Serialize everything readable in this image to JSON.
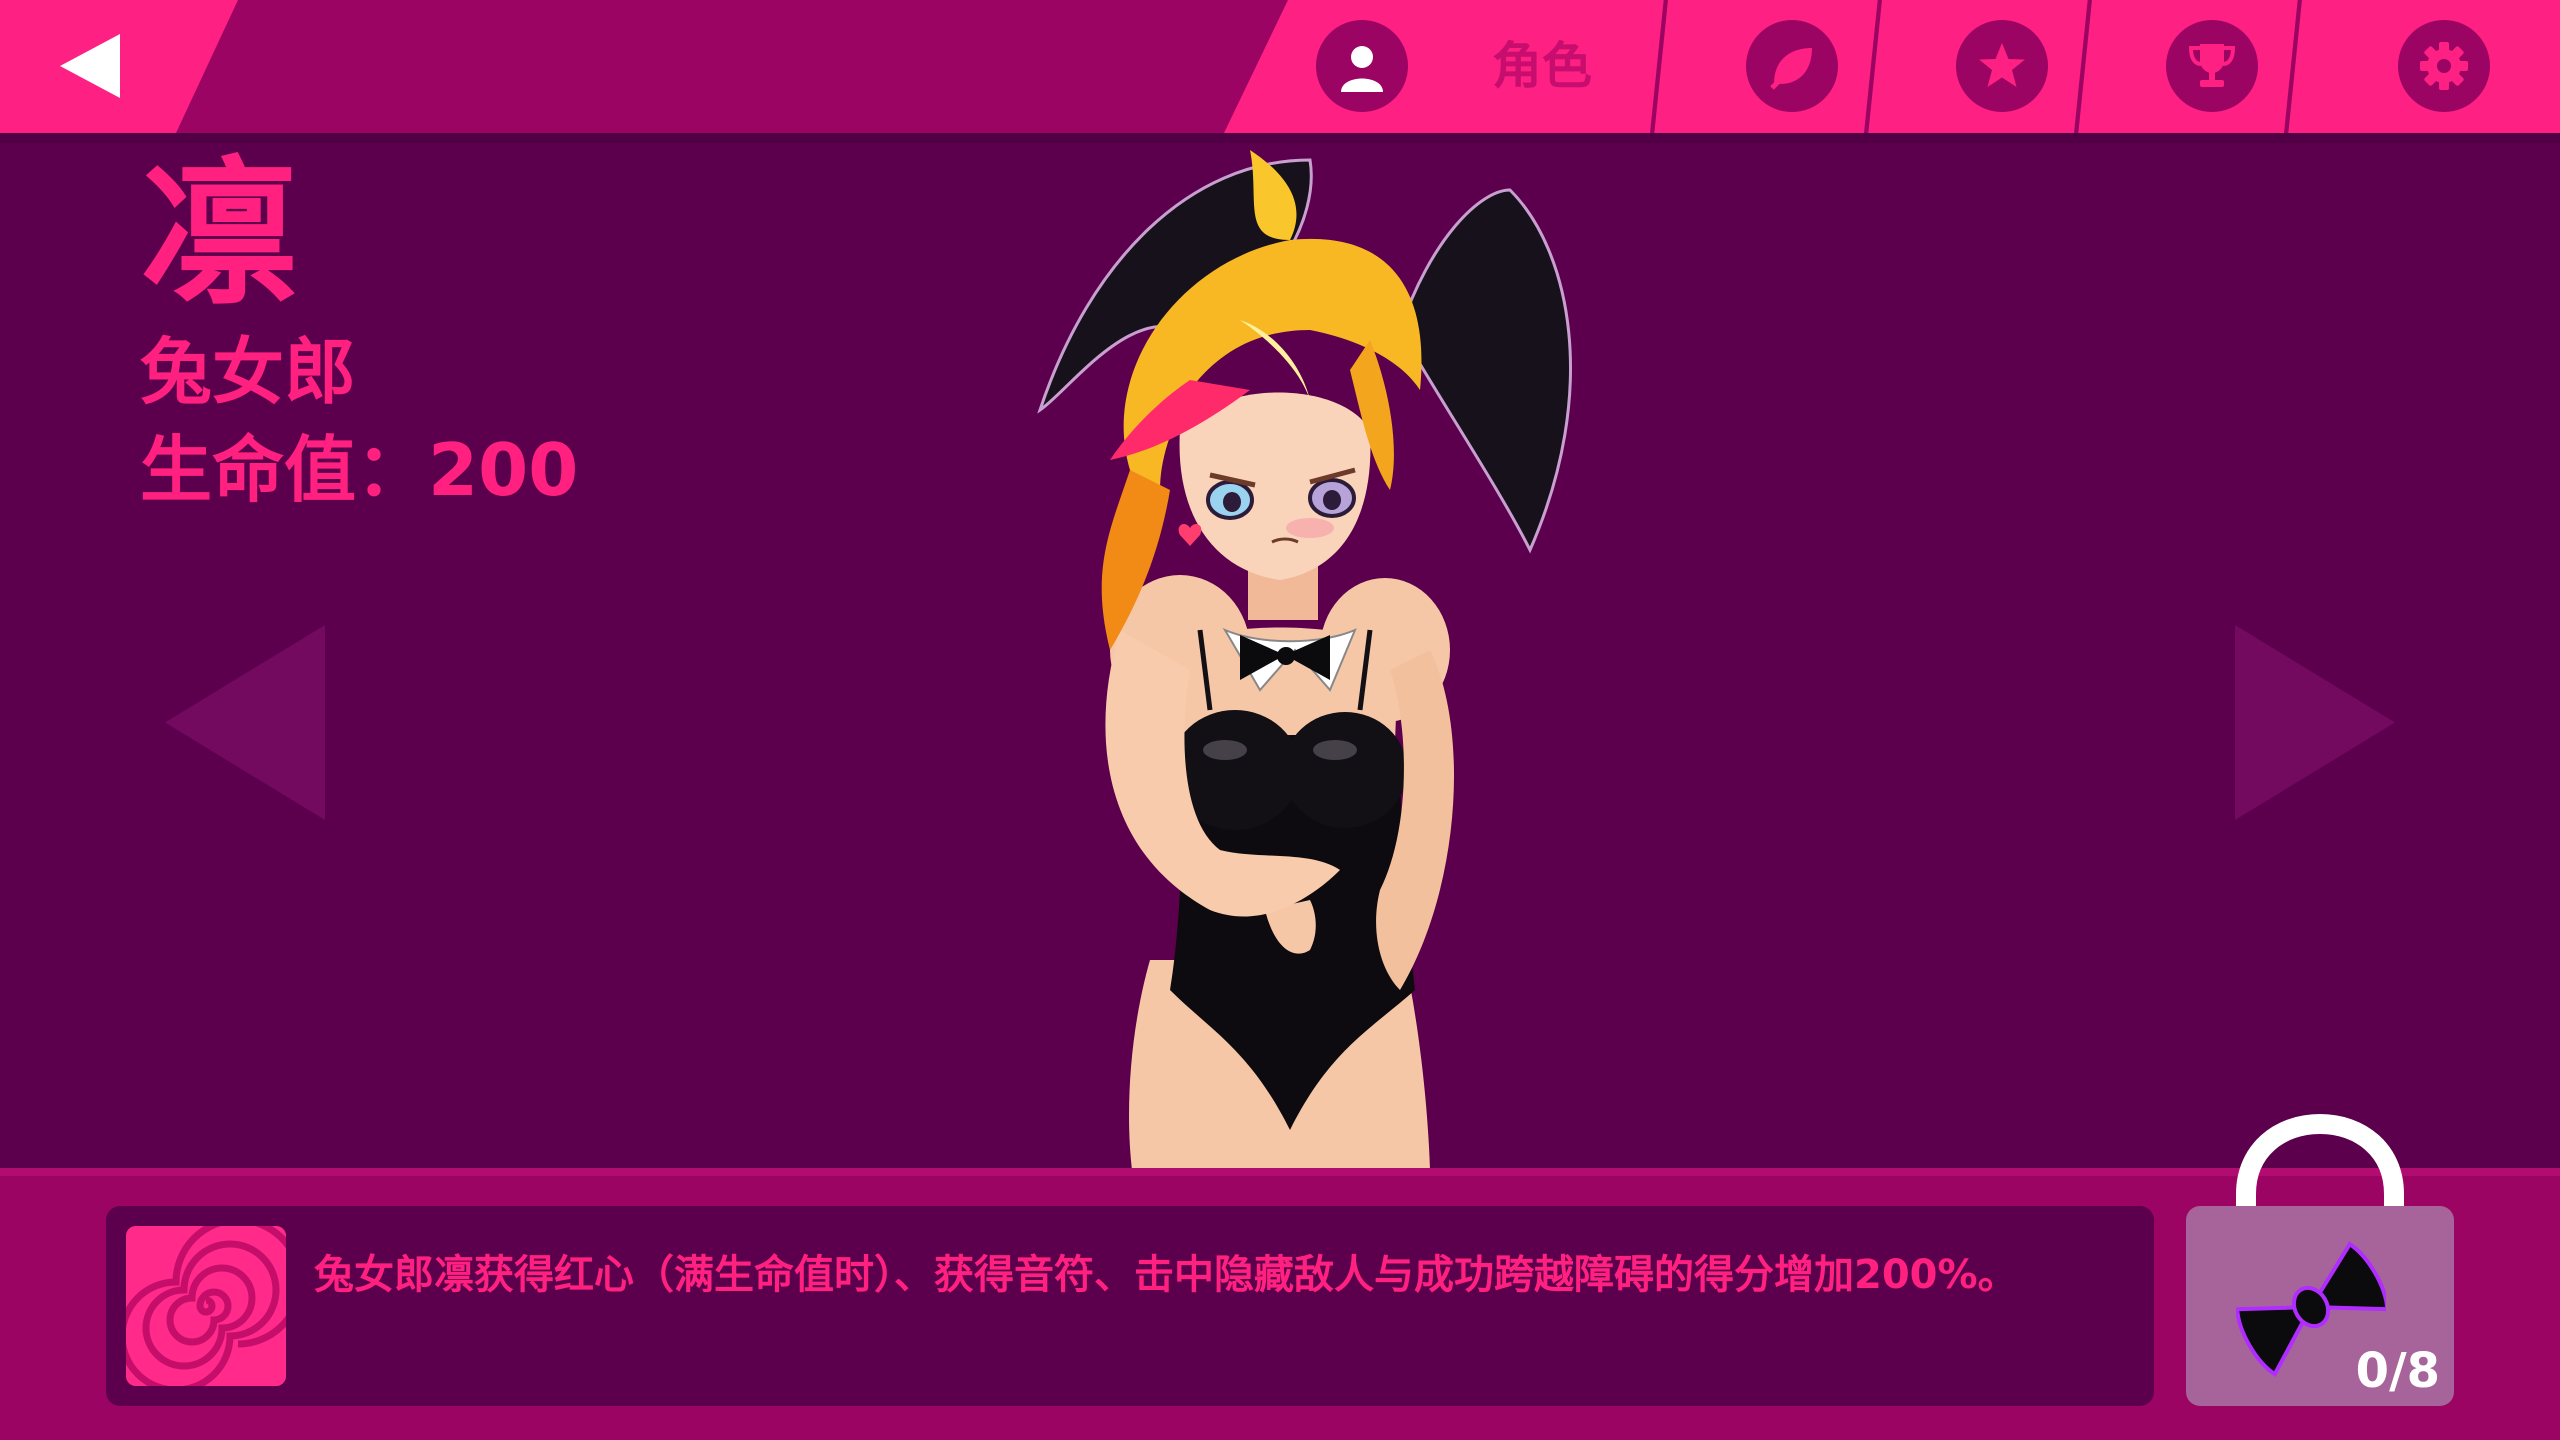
{
  "topbar": {
    "tabs": [
      {
        "id": "character",
        "label": "角色",
        "icon": "user-icon"
      },
      {
        "id": "leaf",
        "icon": "leaf-icon"
      },
      {
        "id": "star",
        "icon": "star-icon"
      },
      {
        "id": "trophy",
        "icon": "trophy-icon"
      },
      {
        "id": "settings",
        "icon": "gear-icon"
      }
    ],
    "active_tab": "character"
  },
  "character": {
    "name": "凛",
    "title": "兔女郎",
    "hp_text": "生命值：200"
  },
  "skill": {
    "icon": "spiral-icon",
    "description": "兔女郎凛获得红心（满生命值时）、获得音符、击中隐藏敌人与成功跨越障碍的得分增加200%。"
  },
  "lock": {
    "icon": "bow-tie-icon",
    "progress": "0/8"
  },
  "colors": {
    "background": "#5c004d",
    "bar": "#9c0463",
    "accent": "#fe2083",
    "text": "#ff2080",
    "lock": "#a7649a"
  }
}
